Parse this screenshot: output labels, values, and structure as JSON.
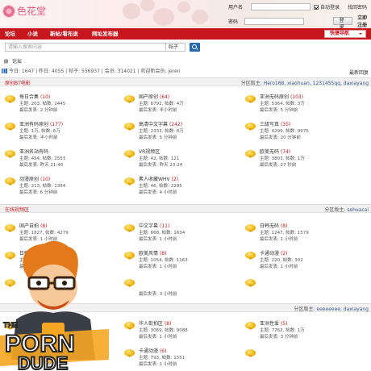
{
  "logo": {
    "text": "色花堂"
  },
  "login": {
    "username_label": "用户名",
    "password_label": "密码",
    "auto_login": "自动登录",
    "forgot": "找回密码",
    "login_button": "登录",
    "register": "立即注册"
  },
  "nav": {
    "items": [
      "论坛",
      "小说",
      "新帖/看布说",
      "网址发布器"
    ],
    "quick_nav": "快捷导航"
  },
  "search": {
    "placeholder": "请输入搜索内容",
    "scope": "帖子"
  },
  "breadcrumb": {
    "current": "论坛"
  },
  "stats": {
    "text": "今日: 1647 | 昨日: 4055 | 帖子: 556937 | 会员: 314021 | 欢迎新会员: jeren",
    "latest": "最新回复"
  },
  "categories": [
    {
      "title": "原创BT电影",
      "moderators": "分区版主: ",
      "moderator_names": "Hero168, xiaohuan, 1231455qq, daxiayang",
      "forums": [
        {
          "name": "每日合集",
          "count": "(10)",
          "stats": "主题: 203, 帖数: 2445",
          "last": "最后发表: 2 分钟前"
        },
        {
          "name": "国产原创",
          "count": "(64)",
          "stats": "主题: 6792, 帖数: 4万",
          "last": "最后发表: 半小时前"
        },
        {
          "name": "亚洲无码原创",
          "count": "(103)",
          "stats": "主题: 5364, 帖数: 3万",
          "last": "最后发表: 5 分钟前"
        },
        {
          "name": "亚洲有码原创",
          "count": "(177)",
          "stats": "主题: 1万, 帖数: 6万",
          "last": "最后发表: 半小时前"
        },
        {
          "name": "高清中文字幕",
          "count": "(242)",
          "stats": "主题: 2333, 帖数: 8万",
          "last": "最后发表: 5 分钟前"
        },
        {
          "name": "三级写真",
          "count": "(35)",
          "stats": "主题: 4299, 帖数: 9975",
          "last": "最后发表: 20 分钟前"
        },
        {
          "name": "亚洲名站有码",
          "count": "",
          "stats": "主题: 454, 帖数: 2553",
          "last": "最后发表: 昨天 21:40"
        },
        {
          "name": "VR视频区",
          "count": "",
          "stats": "主题: 42, 帖数: 121",
          "last": "最后发表: 昨天 23:24"
        },
        {
          "name": "欧美无码",
          "count": "(74)",
          "stats": "主题: 3803, 帖数: 1万",
          "last": "最后发表: 27 秒前"
        },
        {
          "name": "动漫原创",
          "count": "(10)",
          "stats": "主题: 213, 帖数: 1354",
          "last": "最后发表: 6 分钟前"
        },
        {
          "name": "素人收藏WHV",
          "count": "(2)",
          "stats": "主题: 46, 帖数: 2295",
          "last": "最后发表: 4 小时前"
        }
      ]
    },
    {
      "title": "在线视频区",
      "moderators": "分区版主: ",
      "moderator_names": "sehuacai",
      "forums": [
        {
          "name": "国产自拍",
          "count": "(8)",
          "stats": "主题: 1827, 帖数: 4279",
          "last": "最后发表: 1 小时前"
        },
        {
          "name": "中文字幕",
          "count": "(11)",
          "stats": "主题: 668, 帖数: 1634",
          "last": "最后发表: 1 小时前"
        },
        {
          "name": "日韩无码",
          "count": "(8)",
          "stats": "主题: 1247, 帖数: 1579",
          "last": "最后发表: 1 小时前"
        },
        {
          "name": "日韩有码",
          "count": "",
          "stats": "主题: ",
          "last": "最后发表: "
        },
        {
          "name": "欧美风情",
          "count": "(8)",
          "stats": "主题: 1054, 帖数: 1163",
          "last": "最后发表: 1 小时前"
        },
        {
          "name": "卡通动漫",
          "count": "(2)",
          "stats": "主题: 220, 帖数: 302",
          "last": "最后发表: 1 小时前"
        },
        {
          "name": "",
          "count": "",
          "stats": "",
          "last": ""
        },
        {
          "name": "",
          "count": "",
          "stats": "",
          "last": "最后发表: 3 小时前"
        },
        {
          "name": "",
          "count": "",
          "stats": "",
          "last": ""
        }
      ]
    },
    {
      "title": "",
      "moderators": "分区版主: ",
      "moderator_names": "eeeeeeee, daxiayang",
      "forums": [
        {
          "name": "",
          "count": "",
          "stats": "",
          "last": ""
        },
        {
          "name": "华人街拍区",
          "count": "(8)",
          "stats": "主题: 3069, 帖数: 9088",
          "last": "最后发表: 1 小时前"
        },
        {
          "name": "亚洲性爱",
          "count": "(5)",
          "stats": "主题: 7762, 帖数: 1万",
          "last": "最后发表: 3 分钟前"
        },
        {
          "name": "",
          "count": "",
          "stats": "主题: 3530, 帖数: 8771",
          "last": "最后发表: 1 小时前"
        },
        {
          "name": "卡通动漫",
          "count": "(6)",
          "stats": "主题: 793, 帖数: 1551",
          "last": "最后发表: 1 小时前"
        },
        {
          "name": "",
          "count": "",
          "stats": "",
          "last": ""
        }
      ]
    }
  ],
  "mascot": {
    "brand_top": "THE",
    "brand_main": "PORN",
    "brand_bottom": "DUDE"
  },
  "colors": {
    "accent": "#c8161d",
    "header_bg": "#f1f1f1",
    "link": "#3a5a8c"
  }
}
